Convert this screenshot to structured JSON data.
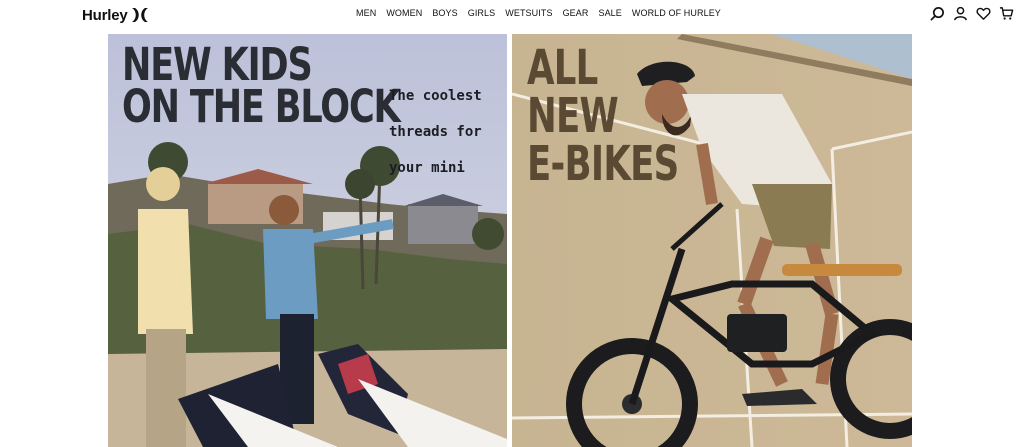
{
  "brand": {
    "name": "Hurley"
  },
  "nav": {
    "items": [
      {
        "label": "MEN"
      },
      {
        "label": "WOMEN"
      },
      {
        "label": "BOYS"
      },
      {
        "label": "GIRLS"
      },
      {
        "label": "WETSUITS"
      },
      {
        "label": "GEAR"
      },
      {
        "label": "SALE"
      },
      {
        "label": "WORLD OF HURLEY"
      }
    ]
  },
  "header_icons": [
    "search-icon",
    "account-icon",
    "wishlist-heart-icon",
    "cart-icon"
  ],
  "hero": {
    "left": {
      "headline_line1": "NEW KIDS",
      "headline_line2": "ON THE BLOCK",
      "tagline_line1": "The coolest",
      "tagline_line2": "threads for",
      "tagline_line3": "your mini"
    },
    "right": {
      "headline_line1": "ALL",
      "headline_line2": "NEW",
      "headline_line3": "E-BIKES"
    }
  },
  "colors": {
    "left_sky": "#c9cde0",
    "right_wall": "#c9b592",
    "text_dark": "#2a2d33",
    "text_brown": "#5a4a34"
  }
}
